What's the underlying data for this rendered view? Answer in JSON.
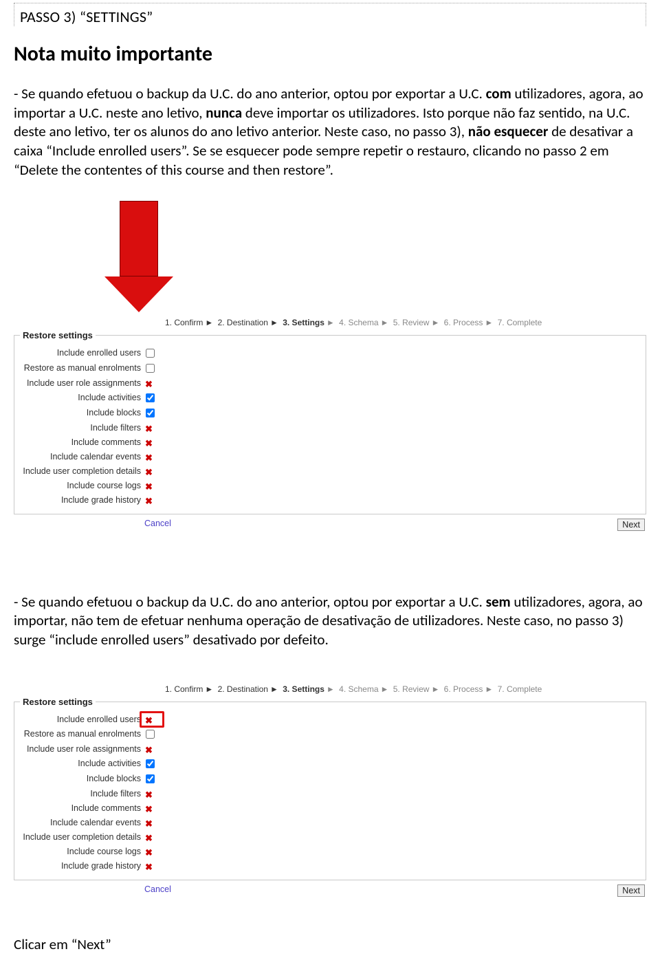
{
  "header": {
    "passo": "PASSO 3) “SETTINGS”"
  },
  "nota_title": "Nota muito importante",
  "para1": {
    "t1": "- Se quando efetuou o backup da U.C. do ano anterior, optou por  exportar a U.C. ",
    "b1": "com",
    "t2": " utilizadores, agora, ao importar a U.C. neste ano letivo, ",
    "b2": "nunca",
    "t3": " deve importar os utilizadores. Isto porque não faz sentido, na U.C. deste ano letivo, ter os alunos do ano letivo anterior. Neste caso, no passo 3), ",
    "b3": "não esquecer",
    "t4": " de desativar a caixa “Include enrolled users”. Se se esquecer pode sempre repetir o restauro, clicando no passo 2 em “Delete the contentes of this course and then restore”."
  },
  "steps": {
    "s1": "1. Confirm",
    "s2": "2. Destination",
    "s3": "3. Settings",
    "s4": "4. Schema",
    "s5": "5. Review",
    "s6": "6. Process",
    "s7": "7. Complete",
    "arrow": "►"
  },
  "fieldset_legend": "Restore settings",
  "settings": {
    "enrolled": "Include enrolled users",
    "manual": "Restore as manual enrolments",
    "role": "Include user role assignments",
    "activities": "Include activities",
    "blocks": "Include blocks",
    "filters": "Include filters",
    "comments": "Include comments",
    "calendar": "Include calendar events",
    "completion": "Include user completion details",
    "logs": "Include course logs",
    "grade": "Include grade history"
  },
  "x": "✖",
  "buttons": {
    "cancel": "Cancel",
    "next": "Next"
  },
  "para2": {
    "t1": "- Se quando efetuou o backup da U.C. do ano anterior, optou por  exportar a U.C. ",
    "b1": "sem",
    "t2": " utilizadores, agora, ao importar, não tem de efetuar nenhuma operação de desativação de utilizadores. Neste caso, no passo 3) surge “include enrolled users” desativado por defeito."
  },
  "final": "Clicar em “Next”"
}
